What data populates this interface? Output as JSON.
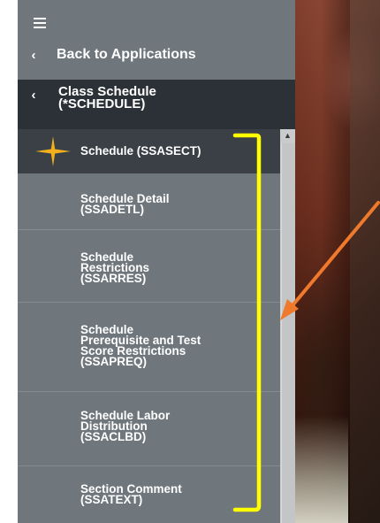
{
  "nav": {
    "back_label": "Back to Applications",
    "parent_label": "Class Schedule\n(*SCHEDULE)",
    "active_item": "Schedule (SSASECT)",
    "items": [
      {
        "label": "Schedule Detail\n(SSADETL)"
      },
      {
        "label": "Schedule\nRestrictions\n(SSARRES)"
      },
      {
        "label": "Schedule\nPrerequisite and Test\nScore Restrictions\n(SSAPREQ)"
      },
      {
        "label": "Schedule Labor\nDistribution\n(SSACLBD)"
      },
      {
        "label": "Section Comment\n(SSATEXT)"
      }
    ]
  },
  "icons": {
    "menu": "hamburger-icon",
    "back": "chevron-left-icon",
    "favorite": "sparkle-star-icon",
    "scroll_up": "caret-up-icon"
  },
  "colors": {
    "sidebar": "#6f777d",
    "parent_row": "#2b3136",
    "active_row": "#3a4046",
    "star": "#f2b01e",
    "bracket": "#ffff00",
    "arrow": "#f07a2c"
  }
}
